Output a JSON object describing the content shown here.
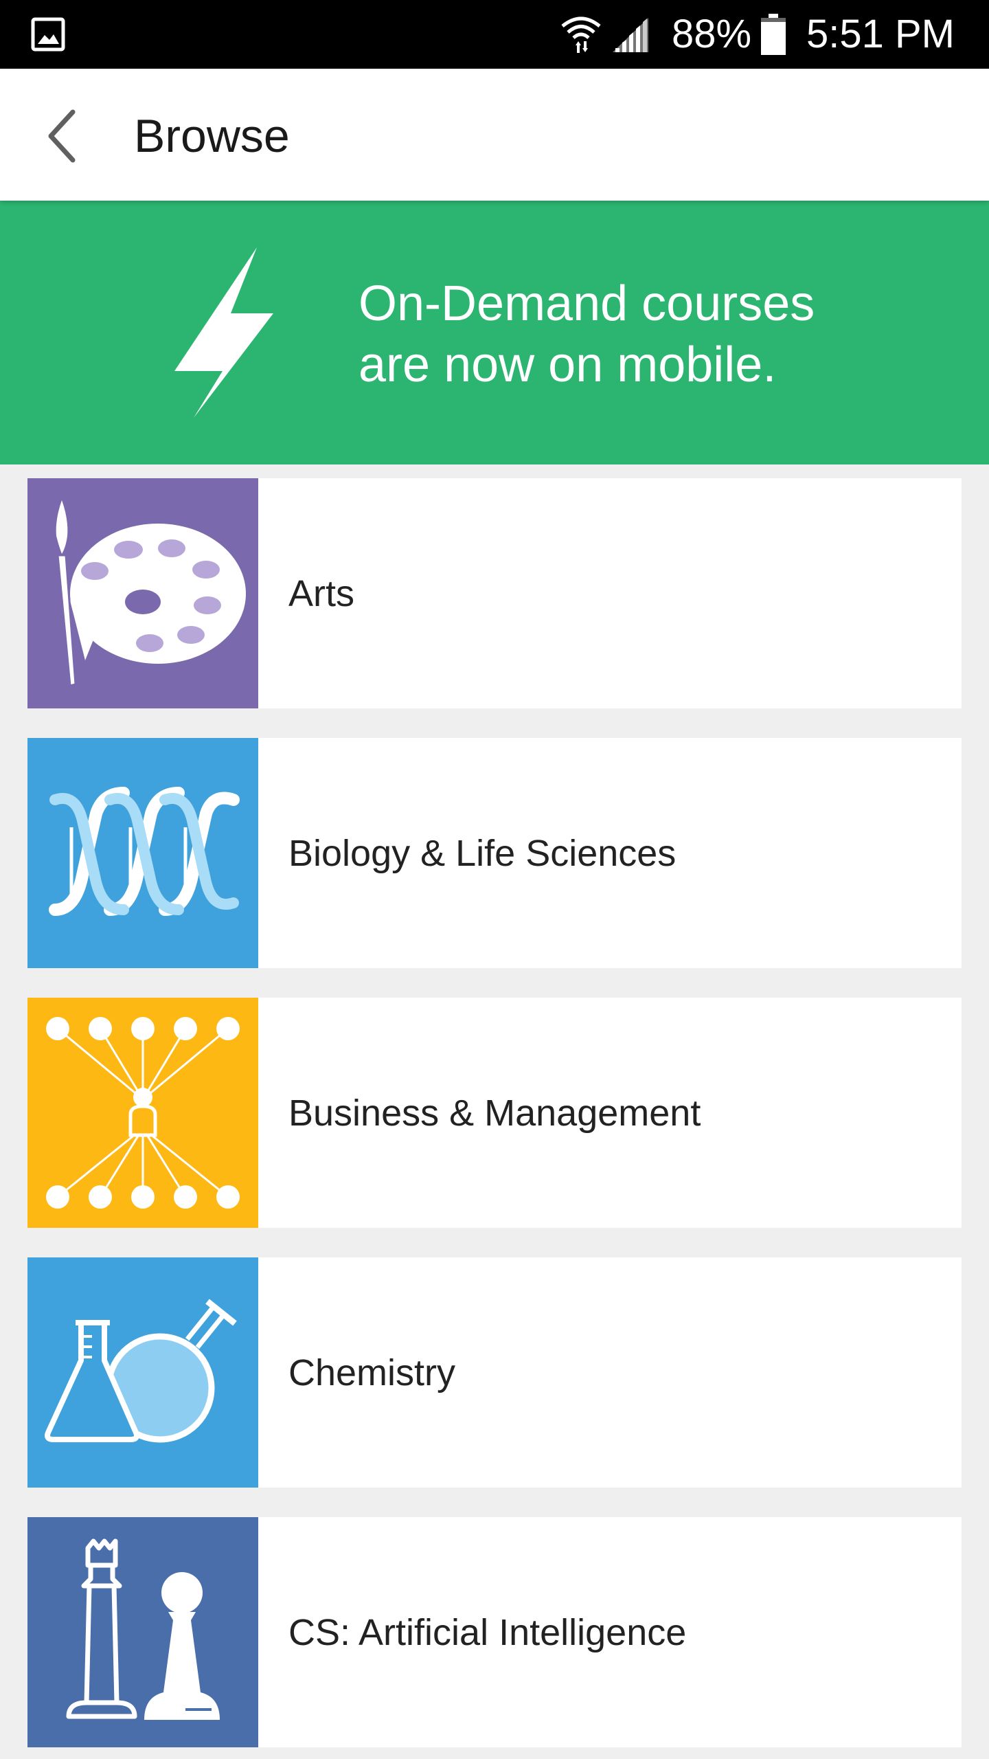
{
  "status_bar": {
    "battery_percent": "88%",
    "time": "5:51 PM",
    "icons": [
      "gallery-icon",
      "wifi-icon",
      "signal-icon",
      "battery-icon"
    ]
  },
  "app_bar": {
    "title": "Browse",
    "back_icon": "back-chevron-icon"
  },
  "banner": {
    "line1": "On-Demand courses",
    "line2": "are now on mobile.",
    "icon": "lightning-bolt-icon",
    "color": "#2cb571"
  },
  "categories": [
    {
      "label": "Arts",
      "icon": "paint-palette-icon",
      "color": "#7b69ad"
    },
    {
      "label": "Biology & Life Sciences",
      "icon": "dna-helix-icon",
      "color": "#3fa2dc"
    },
    {
      "label": "Business & Management",
      "icon": "network-people-icon",
      "color": "#fdb813"
    },
    {
      "label": "Chemistry",
      "icon": "lab-flasks-icon",
      "color": "#3fa2dc"
    },
    {
      "label": "CS: Artificial Intelligence",
      "icon": "chess-pieces-icon",
      "color": "#4a6ea9"
    }
  ]
}
